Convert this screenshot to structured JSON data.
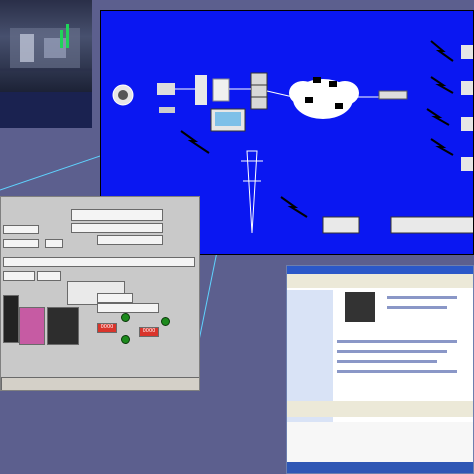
{
  "camera_window": {
    "caption_lines": [
      "",
      ""
    ]
  },
  "network_diagram": {
    "background": "#0a17f2",
    "labels": [
      "",
      "",
      "",
      ""
    ]
  },
  "labview_panel": {
    "numeric_a": "0000",
    "numeric_b": "0000",
    "title_line": ""
  },
  "browser_window": {
    "taskbar_label": ""
  },
  "colors": {
    "desktop": "#5c5f8e",
    "link_lines": "#5fd3ff",
    "panel_gray": "#c9c9c9"
  }
}
